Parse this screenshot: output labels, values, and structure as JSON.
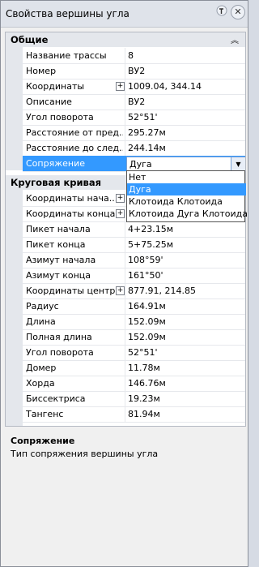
{
  "window": {
    "title": "Свойства вершины угла"
  },
  "sections": {
    "general": "Общие",
    "curve": "Круговая кривая"
  },
  "general_rows": [
    {
      "name": "Название трассы",
      "value": "8"
    },
    {
      "name": "Номер",
      "value": "ВУ2"
    },
    {
      "name": "Координаты",
      "value": "1009.04, 344.14"
    },
    {
      "name": "Описание",
      "value": "ВУ2"
    },
    {
      "name": "Угол поворота",
      "value": "52°51'"
    },
    {
      "name": "Расстояние от пред...",
      "value": "295.27м"
    },
    {
      "name": "Расстояние до след...",
      "value": "244.14м"
    },
    {
      "name": "Сопряжение",
      "value": "Дуга"
    }
  ],
  "curve_rows": [
    {
      "name": "Координаты нача...",
      "value": ""
    },
    {
      "name": "Координаты конца",
      "value": ""
    },
    {
      "name": "Пикет начала",
      "value": "4+23.15м"
    },
    {
      "name": "Пикет конца",
      "value": "5+75.25м"
    },
    {
      "name": "Азимут начала",
      "value": "108°59'"
    },
    {
      "name": "Азимут конца",
      "value": "161°50'"
    },
    {
      "name": "Координаты центра",
      "value": "877.91, 214.85"
    },
    {
      "name": "Радиус",
      "value": "164.91м"
    },
    {
      "name": "Длина",
      "value": "152.09м"
    },
    {
      "name": "Полная длина",
      "value": "152.09м"
    },
    {
      "name": "Угол поворота",
      "value": "52°51'"
    },
    {
      "name": "Домер",
      "value": "11.78м"
    },
    {
      "name": "Хорда",
      "value": "146.76м"
    },
    {
      "name": "Биссектриса",
      "value": "19.23м"
    },
    {
      "name": "Тангенс",
      "value": "81.94м"
    }
  ],
  "dropdown_options": [
    "Нет",
    "Дуга",
    "Клотоида Клотоида",
    "Клотоида Дуга Клотоида"
  ],
  "description": {
    "title": "Сопряжение",
    "text": "Тип сопряжения вершины угла"
  },
  "colors": {
    "selection": "#3399ff",
    "category": "#e4e7ec"
  }
}
